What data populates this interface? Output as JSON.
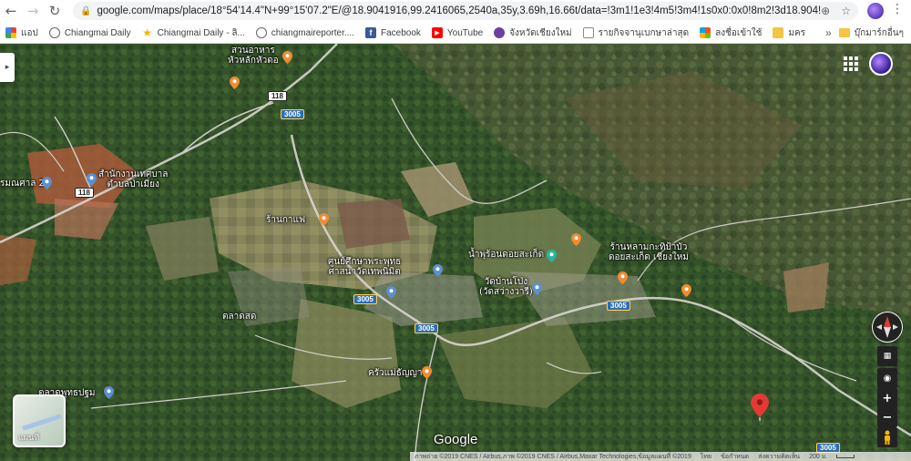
{
  "browser": {
    "url": "google.com/maps/place/18°54'14.4\"N+99°15'07.2\"E/@18.9041916,99.2416065,2540a,35y,3.69h,16.66t/data=!3m1!1e3!4m5!3m4!1s0x0:0x0!8m2!3d18.904!4d99.252",
    "bookmarks": [
      {
        "label": "แอป",
        "icon": "apps-icon"
      },
      {
        "label": "Chiangmai Daily",
        "icon": "globe-icon"
      },
      {
        "label": "Chiangmai Daily - ลิ...",
        "icon": "star-icon"
      },
      {
        "label": "chiangmaireporter....",
        "icon": "globe-icon"
      },
      {
        "label": "Facebook",
        "icon": "facebook-icon"
      },
      {
        "label": "YouTube",
        "icon": "youtube-icon"
      },
      {
        "label": "จังหวัดเชียงใหม่",
        "icon": "seal-icon"
      },
      {
        "label": "รายกิจจานุเบกษาล่าสุด",
        "icon": "document-icon"
      },
      {
        "label": "ลงชื่อเข้าใช้",
        "icon": "windows-icon"
      },
      {
        "label": "มคร",
        "icon": "folder-icon"
      }
    ],
    "other_bookmarks": "บุ๊กมาร์กอื่นๆ",
    "overflow": "»"
  },
  "map": {
    "labels": [
      {
        "text": "สวนอาหาร\nหัวหลักหัวดอ"
      },
      {
        "text": "สำนักงานเทศบาล\nตำบลป่าเมี่ยง"
      },
      {
        "text": "รมณศาล 2"
      },
      {
        "text": "ร้านกาแฟ"
      },
      {
        "text": "ศูนย์ศึกษาพระพุทธ\nศาสนาวัดเทพนิมิต"
      },
      {
        "text": "น้ำพุร้อนดอยสะเก็ด"
      },
      {
        "text": "วัดบ้านโป่ง\n(วัดสว่างวารี)"
      },
      {
        "text": "ร้านหลามกะทิป้าบัว\nดอยสะเก็ด เชียงใหม่"
      },
      {
        "text": "ตลาดสด"
      },
      {
        "text": "ครัวแม่ธัญญา"
      },
      {
        "text": "ตลาดพุทธปฐม"
      }
    ],
    "road_shields": [
      {
        "text": "118",
        "style": "white"
      },
      {
        "text": "3005",
        "style": "blue"
      },
      {
        "text": "118",
        "style": "white"
      },
      {
        "text": "3005",
        "style": "blue"
      },
      {
        "text": "3005",
        "style": "blue"
      },
      {
        "text": "3005",
        "style": "blue"
      },
      {
        "text": "3005",
        "style": "blue"
      }
    ],
    "layer_toggle_label": "แผนที่",
    "logo": "Google",
    "attribution": {
      "imagery": "ภาพถ่าย ©2019 CNES / Airbus,ภาพ ©2019 CNES / Airbus,Maxar Technologies,ข้อมูลแผนที่ ©2019",
      "country": "ไทย",
      "terms": "ข้อกำหนด",
      "feedback": "ส่งความคิดเห็น",
      "scale": "200 ม."
    }
  }
}
